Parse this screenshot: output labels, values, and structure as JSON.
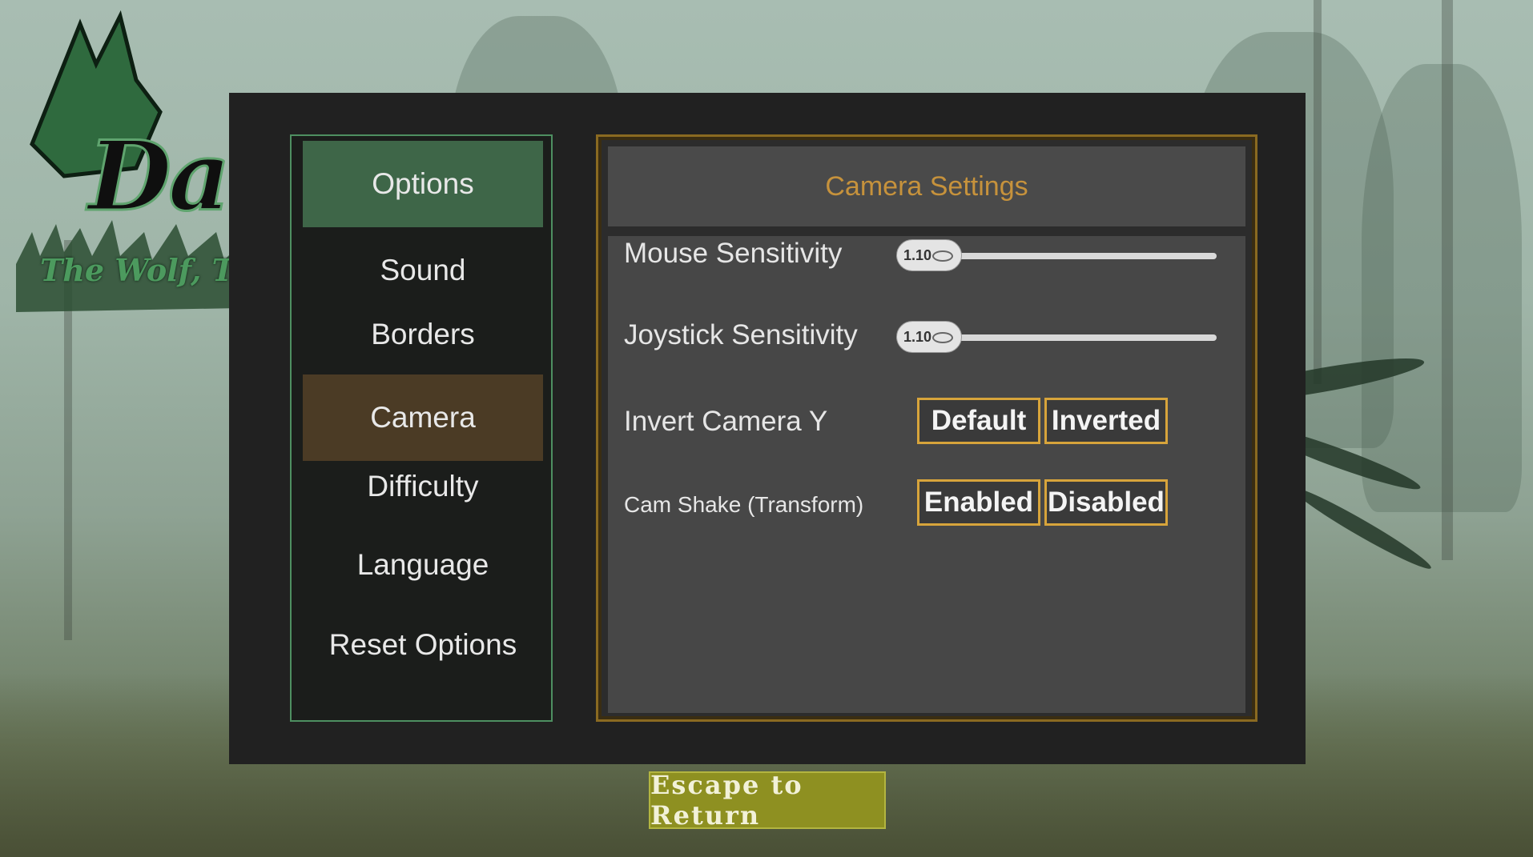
{
  "logo": {
    "title": "Daemon",
    "subtitle": "The Wolf, The Witch & The Labyrinth"
  },
  "sidebar": {
    "header": "Options",
    "items": [
      {
        "label": "Sound"
      },
      {
        "label": "Borders"
      },
      {
        "label": "Camera",
        "active": true
      },
      {
        "label": "Difficulty"
      },
      {
        "label": "Language"
      },
      {
        "label": "Reset Options"
      }
    ]
  },
  "camera": {
    "title": "Camera Settings",
    "mouse_sensitivity": {
      "label": "Mouse Sensitivity",
      "value": "1.10"
    },
    "joystick_sensitivity": {
      "label": "Joystick Sensitivity",
      "value": "1.10"
    },
    "invert_y": {
      "label": "Invert Camera Y",
      "options": [
        "Default",
        "Inverted"
      ]
    },
    "cam_shake": {
      "label": "Cam Shake (Transform)",
      "options": [
        "Enabled",
        "Disabled"
      ]
    }
  },
  "footer": {
    "escape_label": "Escape to Return"
  },
  "colors": {
    "accent_green": "#3e6648",
    "active_brown": "#4b3b25",
    "gold": "#d7a43b",
    "header_text": "#c6923c",
    "escape_bg": "#8e9021"
  },
  "icons": {
    "cursor": "pointer-cursor-icon",
    "slider_grip": "slider-grip-icon",
    "wolf": "wolf-head-icon"
  }
}
